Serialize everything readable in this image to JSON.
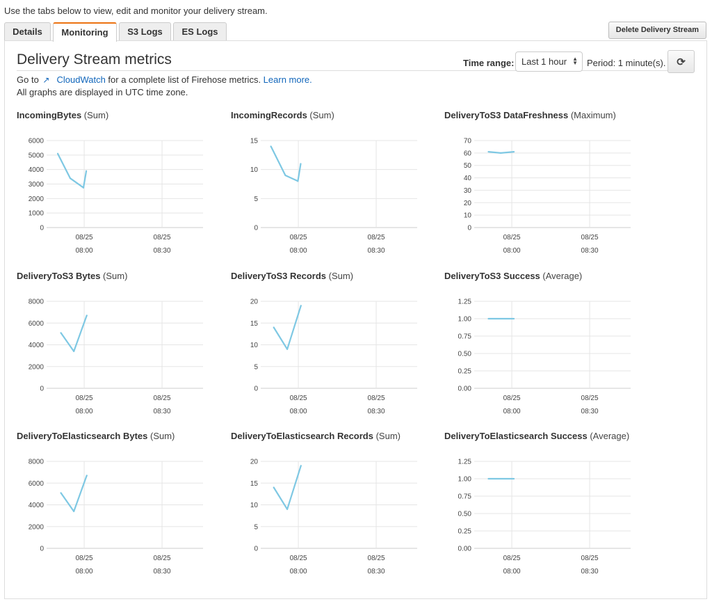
{
  "intro_text": "Use the tabs below to view, edit and monitor your delivery stream.",
  "tabs": [
    {
      "label": "Details",
      "active": false
    },
    {
      "label": "Monitoring",
      "active": true
    },
    {
      "label": "S3 Logs",
      "active": false
    },
    {
      "label": "ES Logs",
      "active": false
    }
  ],
  "delete_button": "Delete Delivery Stream",
  "panel": {
    "title": "Delivery Stream metrics",
    "time_range_label": "Time range:",
    "time_range_value": "Last 1 hour",
    "period_text": "Period:  1  minute(s).",
    "refresh_icon": "refresh-icon",
    "goto_prefix": "Go to",
    "external_icon": "external-link-icon",
    "cloudwatch_link": "CloudWatch",
    "goto_suffix": " for a complete list of Firehose metrics. ",
    "learn_more": "Learn more.",
    "utc_note": "All graphs are displayed in UTC time zone."
  },
  "colors": {
    "line": "#7ec8e3",
    "grid": "#e5e5e5",
    "active_tab": "#ec7211",
    "link": "#1166bb"
  },
  "chart_data": [
    {
      "type": "line",
      "metric": "IncomingBytes",
      "stat": "(Sum)",
      "yticks": [
        "6000",
        "5000",
        "4000",
        "3000",
        "2000",
        "1000",
        "0"
      ],
      "ylim": [
        0,
        6000
      ],
      "xlim_minutes": [
        -14.5,
        45.8
      ],
      "xticks": [
        {
          "minutes": 0,
          "date": "08/25",
          "time": "08:00"
        },
        {
          "minutes": 30,
          "date": "08/25",
          "time": "08:30"
        }
      ],
      "x_minutes": [
        -10.2,
        -5.4,
        -0.3,
        0.8
      ],
      "values": [
        5100,
        3400,
        2750,
        3900
      ],
      "grid": true
    },
    {
      "type": "line",
      "metric": "IncomingRecords",
      "stat": "(Sum)",
      "yticks": [
        "15",
        "10",
        "5",
        "0"
      ],
      "ylim": [
        0,
        15
      ],
      "xlim_minutes": [
        -14.5,
        45.8
      ],
      "xticks": [
        {
          "minutes": 0,
          "date": "08/25",
          "time": "08:00"
        },
        {
          "minutes": 30,
          "date": "08/25",
          "time": "08:30"
        }
      ],
      "x_minutes": [
        -10.6,
        -5.0,
        -0.2,
        0.9
      ],
      "values": [
        14,
        9,
        8,
        11
      ],
      "grid": true
    },
    {
      "type": "line",
      "metric": "DeliveryToS3 DataFreshness",
      "stat": "(Maximum)",
      "yticks": [
        "70",
        "60",
        "50",
        "40",
        "30",
        "20",
        "10",
        "0"
      ],
      "ylim": [
        0,
        70
      ],
      "xlim_minutes": [
        -14.5,
        45.8
      ],
      "xticks": [
        {
          "minutes": 0,
          "date": "08/25",
          "time": "08:00"
        },
        {
          "minutes": 30,
          "date": "08/25",
          "time": "08:30"
        }
      ],
      "x_minutes": [
        -9.0,
        -4.3,
        0.8
      ],
      "values": [
        61,
        60,
        61
      ],
      "grid": true
    },
    {
      "type": "line",
      "metric": "DeliveryToS3 Bytes",
      "stat": "(Sum)",
      "yticks": [
        "8000",
        "6000",
        "4000",
        "2000",
        "0"
      ],
      "ylim": [
        0,
        8000
      ],
      "xlim_minutes": [
        -14.5,
        45.8
      ],
      "xticks": [
        {
          "minutes": 0,
          "date": "08/25",
          "time": "08:00"
        },
        {
          "minutes": 30,
          "date": "08/25",
          "time": "08:30"
        }
      ],
      "x_minutes": [
        -9.0,
        -4.0,
        1.0
      ],
      "values": [
        5100,
        3400,
        6700
      ],
      "grid": true
    },
    {
      "type": "line",
      "metric": "DeliveryToS3 Records",
      "stat": "(Sum)",
      "yticks": [
        "20",
        "15",
        "10",
        "5",
        "0"
      ],
      "ylim": [
        0,
        20
      ],
      "xlim_minutes": [
        -14.5,
        45.8
      ],
      "xticks": [
        {
          "minutes": 0,
          "date": "08/25",
          "time": "08:00"
        },
        {
          "minutes": 30,
          "date": "08/25",
          "time": "08:30"
        }
      ],
      "x_minutes": [
        -9.5,
        -4.3,
        1.0
      ],
      "values": [
        14,
        9,
        19
      ],
      "grid": true
    },
    {
      "type": "line",
      "metric": "DeliveryToS3 Success",
      "stat": "(Average)",
      "yticks": [
        "1.25",
        "1.00",
        "0.75",
        "0.50",
        "0.25",
        "0.00"
      ],
      "ylim": [
        0,
        1.25
      ],
      "xlim_minutes": [
        -14.5,
        45.8
      ],
      "xticks": [
        {
          "minutes": 0,
          "date": "08/25",
          "time": "08:00"
        },
        {
          "minutes": 30,
          "date": "08/25",
          "time": "08:30"
        }
      ],
      "x_minutes": [
        -9.0,
        0.8
      ],
      "values": [
        1.0,
        1.0
      ],
      "grid": true
    },
    {
      "type": "line",
      "metric": "DeliveryToElasticsearch Bytes",
      "stat": "(Sum)",
      "yticks": [
        "8000",
        "6000",
        "4000",
        "2000",
        "0"
      ],
      "ylim": [
        0,
        8000
      ],
      "xlim_minutes": [
        -14.5,
        45.8
      ],
      "xticks": [
        {
          "minutes": 0,
          "date": "08/25",
          "time": "08:00"
        },
        {
          "minutes": 30,
          "date": "08/25",
          "time": "08:30"
        }
      ],
      "x_minutes": [
        -9.0,
        -4.0,
        1.0
      ],
      "values": [
        5100,
        3400,
        6700
      ],
      "grid": true
    },
    {
      "type": "line",
      "metric": "DeliveryToElasticsearch Records",
      "stat": "(Sum)",
      "yticks": [
        "20",
        "15",
        "10",
        "5",
        "0"
      ],
      "ylim": [
        0,
        20
      ],
      "xlim_minutes": [
        -14.5,
        45.8
      ],
      "xticks": [
        {
          "minutes": 0,
          "date": "08/25",
          "time": "08:00"
        },
        {
          "minutes": 30,
          "date": "08/25",
          "time": "08:30"
        }
      ],
      "x_minutes": [
        -9.5,
        -4.3,
        1.0
      ],
      "values": [
        14,
        9,
        19
      ],
      "grid": true
    },
    {
      "type": "line",
      "metric": "DeliveryToElasticsearch Success",
      "stat": "(Average)",
      "yticks": [
        "1.25",
        "1.00",
        "0.75",
        "0.50",
        "0.25",
        "0.00"
      ],
      "ylim": [
        0,
        1.25
      ],
      "xlim_minutes": [
        -14.5,
        45.8
      ],
      "xticks": [
        {
          "minutes": 0,
          "date": "08/25",
          "time": "08:00"
        },
        {
          "minutes": 30,
          "date": "08/25",
          "time": "08:30"
        }
      ],
      "x_minutes": [
        -9.0,
        0.8
      ],
      "values": [
        1.0,
        1.0
      ],
      "grid": true
    }
  ]
}
